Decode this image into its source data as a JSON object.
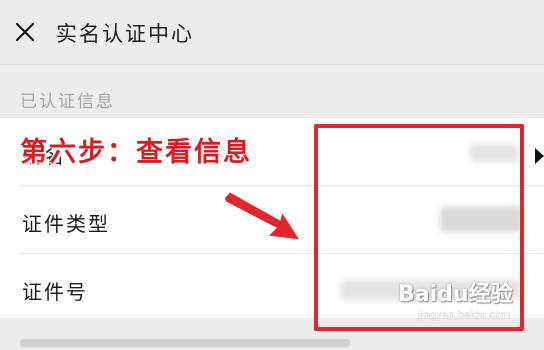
{
  "header": {
    "title": "实名认证中心",
    "close_icon": "close-icon"
  },
  "section": {
    "label": "已认证信息"
  },
  "rows": [
    {
      "label": "姓名"
    },
    {
      "label": "证件类型"
    },
    {
      "label": "证件号"
    }
  ],
  "annotation": {
    "step_caption": "第六步：查看信息",
    "arrow_icon": "red-arrow-icon",
    "box_color": "#e3262d"
  },
  "watermark": {
    "brand": "Baidu经验",
    "url": "jingyan.baidu.com"
  }
}
